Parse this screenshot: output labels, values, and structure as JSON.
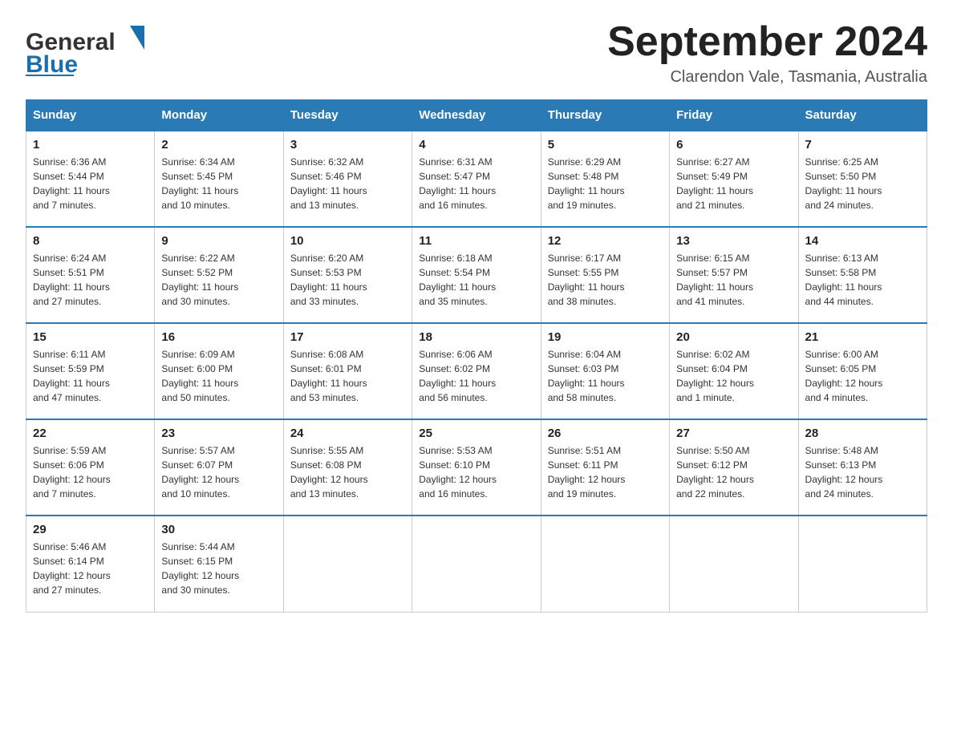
{
  "header": {
    "logo_general": "General",
    "logo_blue": "Blue",
    "month_title": "September 2024",
    "location": "Clarendon Vale, Tasmania, Australia"
  },
  "weekdays": [
    "Sunday",
    "Monday",
    "Tuesday",
    "Wednesday",
    "Thursday",
    "Friday",
    "Saturday"
  ],
  "weeks": [
    [
      {
        "day": "1",
        "sunrise": "6:36 AM",
        "sunset": "5:44 PM",
        "daylight": "11 hours and 7 minutes."
      },
      {
        "day": "2",
        "sunrise": "6:34 AM",
        "sunset": "5:45 PM",
        "daylight": "11 hours and 10 minutes."
      },
      {
        "day": "3",
        "sunrise": "6:32 AM",
        "sunset": "5:46 PM",
        "daylight": "11 hours and 13 minutes."
      },
      {
        "day": "4",
        "sunrise": "6:31 AM",
        "sunset": "5:47 PM",
        "daylight": "11 hours and 16 minutes."
      },
      {
        "day": "5",
        "sunrise": "6:29 AM",
        "sunset": "5:48 PM",
        "daylight": "11 hours and 19 minutes."
      },
      {
        "day": "6",
        "sunrise": "6:27 AM",
        "sunset": "5:49 PM",
        "daylight": "11 hours and 21 minutes."
      },
      {
        "day": "7",
        "sunrise": "6:25 AM",
        "sunset": "5:50 PM",
        "daylight": "11 hours and 24 minutes."
      }
    ],
    [
      {
        "day": "8",
        "sunrise": "6:24 AM",
        "sunset": "5:51 PM",
        "daylight": "11 hours and 27 minutes."
      },
      {
        "day": "9",
        "sunrise": "6:22 AM",
        "sunset": "5:52 PM",
        "daylight": "11 hours and 30 minutes."
      },
      {
        "day": "10",
        "sunrise": "6:20 AM",
        "sunset": "5:53 PM",
        "daylight": "11 hours and 33 minutes."
      },
      {
        "day": "11",
        "sunrise": "6:18 AM",
        "sunset": "5:54 PM",
        "daylight": "11 hours and 35 minutes."
      },
      {
        "day": "12",
        "sunrise": "6:17 AM",
        "sunset": "5:55 PM",
        "daylight": "11 hours and 38 minutes."
      },
      {
        "day": "13",
        "sunrise": "6:15 AM",
        "sunset": "5:57 PM",
        "daylight": "11 hours and 41 minutes."
      },
      {
        "day": "14",
        "sunrise": "6:13 AM",
        "sunset": "5:58 PM",
        "daylight": "11 hours and 44 minutes."
      }
    ],
    [
      {
        "day": "15",
        "sunrise": "6:11 AM",
        "sunset": "5:59 PM",
        "daylight": "11 hours and 47 minutes."
      },
      {
        "day": "16",
        "sunrise": "6:09 AM",
        "sunset": "6:00 PM",
        "daylight": "11 hours and 50 minutes."
      },
      {
        "day": "17",
        "sunrise": "6:08 AM",
        "sunset": "6:01 PM",
        "daylight": "11 hours and 53 minutes."
      },
      {
        "day": "18",
        "sunrise": "6:06 AM",
        "sunset": "6:02 PM",
        "daylight": "11 hours and 56 minutes."
      },
      {
        "day": "19",
        "sunrise": "6:04 AM",
        "sunset": "6:03 PM",
        "daylight": "11 hours and 58 minutes."
      },
      {
        "day": "20",
        "sunrise": "6:02 AM",
        "sunset": "6:04 PM",
        "daylight": "12 hours and 1 minute."
      },
      {
        "day": "21",
        "sunrise": "6:00 AM",
        "sunset": "6:05 PM",
        "daylight": "12 hours and 4 minutes."
      }
    ],
    [
      {
        "day": "22",
        "sunrise": "5:59 AM",
        "sunset": "6:06 PM",
        "daylight": "12 hours and 7 minutes."
      },
      {
        "day": "23",
        "sunrise": "5:57 AM",
        "sunset": "6:07 PM",
        "daylight": "12 hours and 10 minutes."
      },
      {
        "day": "24",
        "sunrise": "5:55 AM",
        "sunset": "6:08 PM",
        "daylight": "12 hours and 13 minutes."
      },
      {
        "day": "25",
        "sunrise": "5:53 AM",
        "sunset": "6:10 PM",
        "daylight": "12 hours and 16 minutes."
      },
      {
        "day": "26",
        "sunrise": "5:51 AM",
        "sunset": "6:11 PM",
        "daylight": "12 hours and 19 minutes."
      },
      {
        "day": "27",
        "sunrise": "5:50 AM",
        "sunset": "6:12 PM",
        "daylight": "12 hours and 22 minutes."
      },
      {
        "day": "28",
        "sunrise": "5:48 AM",
        "sunset": "6:13 PM",
        "daylight": "12 hours and 24 minutes."
      }
    ],
    [
      {
        "day": "29",
        "sunrise": "5:46 AM",
        "sunset": "6:14 PM",
        "daylight": "12 hours and 27 minutes."
      },
      {
        "day": "30",
        "sunrise": "5:44 AM",
        "sunset": "6:15 PM",
        "daylight": "12 hours and 30 minutes."
      },
      null,
      null,
      null,
      null,
      null
    ]
  ],
  "cell_labels": {
    "sunrise": "Sunrise: ",
    "sunset": "Sunset: ",
    "daylight": "Daylight: "
  }
}
